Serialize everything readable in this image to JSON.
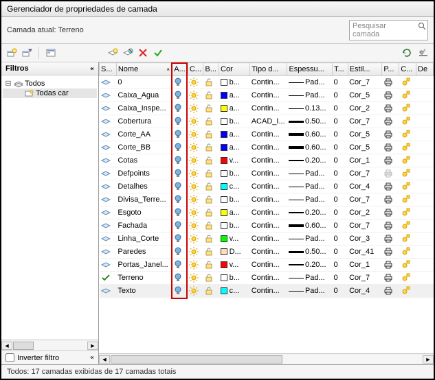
{
  "window": {
    "title": "Gerenciador de propriedades de camada"
  },
  "current_layer": {
    "label": "Camada atual: Terreno"
  },
  "search": {
    "placeholder": "Pesquisar camada"
  },
  "tree": {
    "header": "Filtros",
    "root": "Todos",
    "child": "Todas car"
  },
  "invert": {
    "label": "Inverter filtro"
  },
  "columns": {
    "status": "S...",
    "name": "Nome",
    "on": "A...",
    "freeze": "C...",
    "lock": "B...",
    "color": "Cor",
    "linetype": "Tipo d...",
    "lineweight": "Espessu...",
    "trans": "T...",
    "pstyle": "Estil...",
    "plot": "P...",
    "new": "C...",
    "desc": "De"
  },
  "layers": [
    {
      "name": "0",
      "on": true,
      "color": "#ffffff",
      "colcode": "b...",
      "lt": "Contin...",
      "lw": "Pad...",
      "lwpx": 1,
      "t": "0",
      "ps": "Cor_7",
      "plot": true,
      "active": false
    },
    {
      "name": "Caixa_Agua",
      "on": true,
      "color": "#0000ff",
      "colcode": "a...",
      "lt": "Contin...",
      "lw": "Pad...",
      "lwpx": 1,
      "t": "0",
      "ps": "Cor_5",
      "plot": true,
      "active": false
    },
    {
      "name": "Caixa_Inspe...",
      "on": true,
      "color": "#ffff00",
      "colcode": "a...",
      "lt": "Contin...",
      "lw": "0.13...",
      "lwpx": 1,
      "t": "0",
      "ps": "Cor_2",
      "plot": true,
      "active": false
    },
    {
      "name": "Cobertura",
      "on": true,
      "color": "#ffffff",
      "colcode": "b...",
      "lt": "ACAD_I...",
      "lw": "0.50...",
      "lwpx": 3,
      "t": "0",
      "ps": "Cor_7",
      "plot": true,
      "active": false
    },
    {
      "name": "Corte_AA",
      "on": true,
      "color": "#0000ff",
      "colcode": "a...",
      "lt": "Contin...",
      "lw": "0.60...",
      "lwpx": 4,
      "t": "0",
      "ps": "Cor_5",
      "plot": true,
      "active": false
    },
    {
      "name": "Corte_BB",
      "on": true,
      "color": "#0000ff",
      "colcode": "a...",
      "lt": "Contin...",
      "lw": "0.60...",
      "lwpx": 4,
      "t": "0",
      "ps": "Cor_5",
      "plot": true,
      "active": false
    },
    {
      "name": "Cotas",
      "on": true,
      "color": "#ff0000",
      "colcode": "v...",
      "lt": "Contin...",
      "lw": "0.20...",
      "lwpx": 2,
      "t": "0",
      "ps": "Cor_1",
      "plot": true,
      "active": false
    },
    {
      "name": "Defpoints",
      "on": true,
      "color": "#ffffff",
      "colcode": "b...",
      "lt": "Contin...",
      "lw": "Pad...",
      "lwpx": 1,
      "t": "0",
      "ps": "Cor_7",
      "plot": false,
      "active": false
    },
    {
      "name": "Detalhes",
      "on": true,
      "color": "#00ffff",
      "colcode": "c...",
      "lt": "Contin...",
      "lw": "Pad...",
      "lwpx": 1,
      "t": "0",
      "ps": "Cor_4",
      "plot": true,
      "active": false
    },
    {
      "name": "Divisa_Terre...",
      "on": true,
      "color": "#ffffff",
      "colcode": "b...",
      "lt": "Contin...",
      "lw": "Pad...",
      "lwpx": 1,
      "t": "0",
      "ps": "Cor_7",
      "plot": true,
      "active": false
    },
    {
      "name": "Esgoto",
      "on": true,
      "color": "#ffff00",
      "colcode": "a...",
      "lt": "Contin...",
      "lw": "0.20...",
      "lwpx": 2,
      "t": "0",
      "ps": "Cor_2",
      "plot": true,
      "active": false
    },
    {
      "name": "Fachada",
      "on": true,
      "color": "#ffffff",
      "colcode": "b...",
      "lt": "Contin...",
      "lw": "0.60...",
      "lwpx": 4,
      "t": "0",
      "ps": "Cor_7",
      "plot": true,
      "active": false
    },
    {
      "name": "Linha_Corte",
      "on": true,
      "color": "#00ff00",
      "colcode": "v...",
      "lt": "Contin...",
      "lw": "Pad...",
      "lwpx": 1,
      "t": "0",
      "ps": "Cor_3",
      "plot": true,
      "active": false
    },
    {
      "name": "Paredes",
      "on": true,
      "color": "#ffddbb",
      "colcode": "D...",
      "lt": "Contin...",
      "lw": "0.50...",
      "lwpx": 3,
      "t": "0",
      "ps": "Cor_41",
      "plot": true,
      "active": false
    },
    {
      "name": "Portas_Janel...",
      "on": true,
      "color": "#ff0000",
      "colcode": "v...",
      "lt": "Contin...",
      "lw": "0.20...",
      "lwpx": 2,
      "t": "0",
      "ps": "Cor_1",
      "plot": true,
      "active": false
    },
    {
      "name": "Terreno",
      "on": true,
      "color": "#ffffff",
      "colcode": "b...",
      "lt": "Contin...",
      "lw": "Pad...",
      "lwpx": 1,
      "t": "0",
      "ps": "Cor_7",
      "plot": true,
      "active": true
    },
    {
      "name": "Texto",
      "on": true,
      "color": "#00ffff",
      "colcode": "c...",
      "lt": "Contin...",
      "lw": "Pad...",
      "lwpx": 1,
      "t": "0",
      "ps": "Cor_4",
      "plot": true,
      "active": false,
      "sel": true
    }
  ],
  "status": {
    "text": "Todos: 17 camadas exibidas de 17 camadas totais"
  }
}
